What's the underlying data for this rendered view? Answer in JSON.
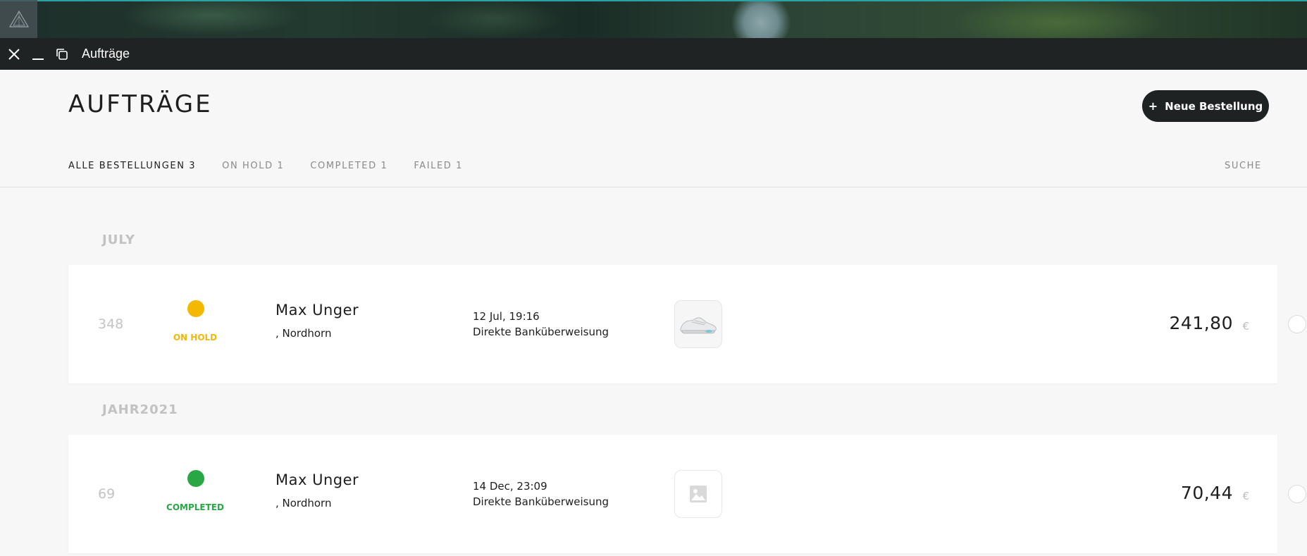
{
  "window": {
    "title": "Aufträge"
  },
  "header": {
    "title": "AUFTRÄGE",
    "new_order_plus": "+",
    "new_order_label": "Neue Bestellung"
  },
  "tabs": [
    {
      "label": "ALLE BESTELLUNGEN 3",
      "active": true
    },
    {
      "label": "ON HOLD 1",
      "active": false
    },
    {
      "label": "COMPLETED 1",
      "active": false
    },
    {
      "label": "FAILED 1",
      "active": false
    }
  ],
  "search": {
    "label": "SUCHE"
  },
  "groups": [
    {
      "heading": "JULY",
      "orders": [
        {
          "number": "348",
          "status": "ON HOLD",
          "status_color": "#f5b800",
          "customer": "Max Unger",
          "city": ", Nordhorn",
          "date": "12 Jul, 19:16",
          "payment": "Direkte Banküberweisung",
          "thumbnail": "sneaker-image",
          "total": "241,80",
          "currency": "€"
        }
      ]
    },
    {
      "heading": "JAHR2021",
      "orders": [
        {
          "number": "69",
          "status": "COMPLETED",
          "status_color": "#29a745",
          "customer": "Max Unger",
          "city": ", Nordhorn",
          "date": "14 Dec, 23:09",
          "payment": "Direkte Banküberweisung",
          "thumbnail": "image-placeholder-icon",
          "total": "70,44",
          "currency": "€"
        }
      ]
    }
  ],
  "colors": {
    "titlebar": "#202324",
    "button_dark": "#1f2223",
    "on_hold": "#f5b800",
    "completed": "#29a745",
    "muted_text": "#8a8a8a"
  }
}
